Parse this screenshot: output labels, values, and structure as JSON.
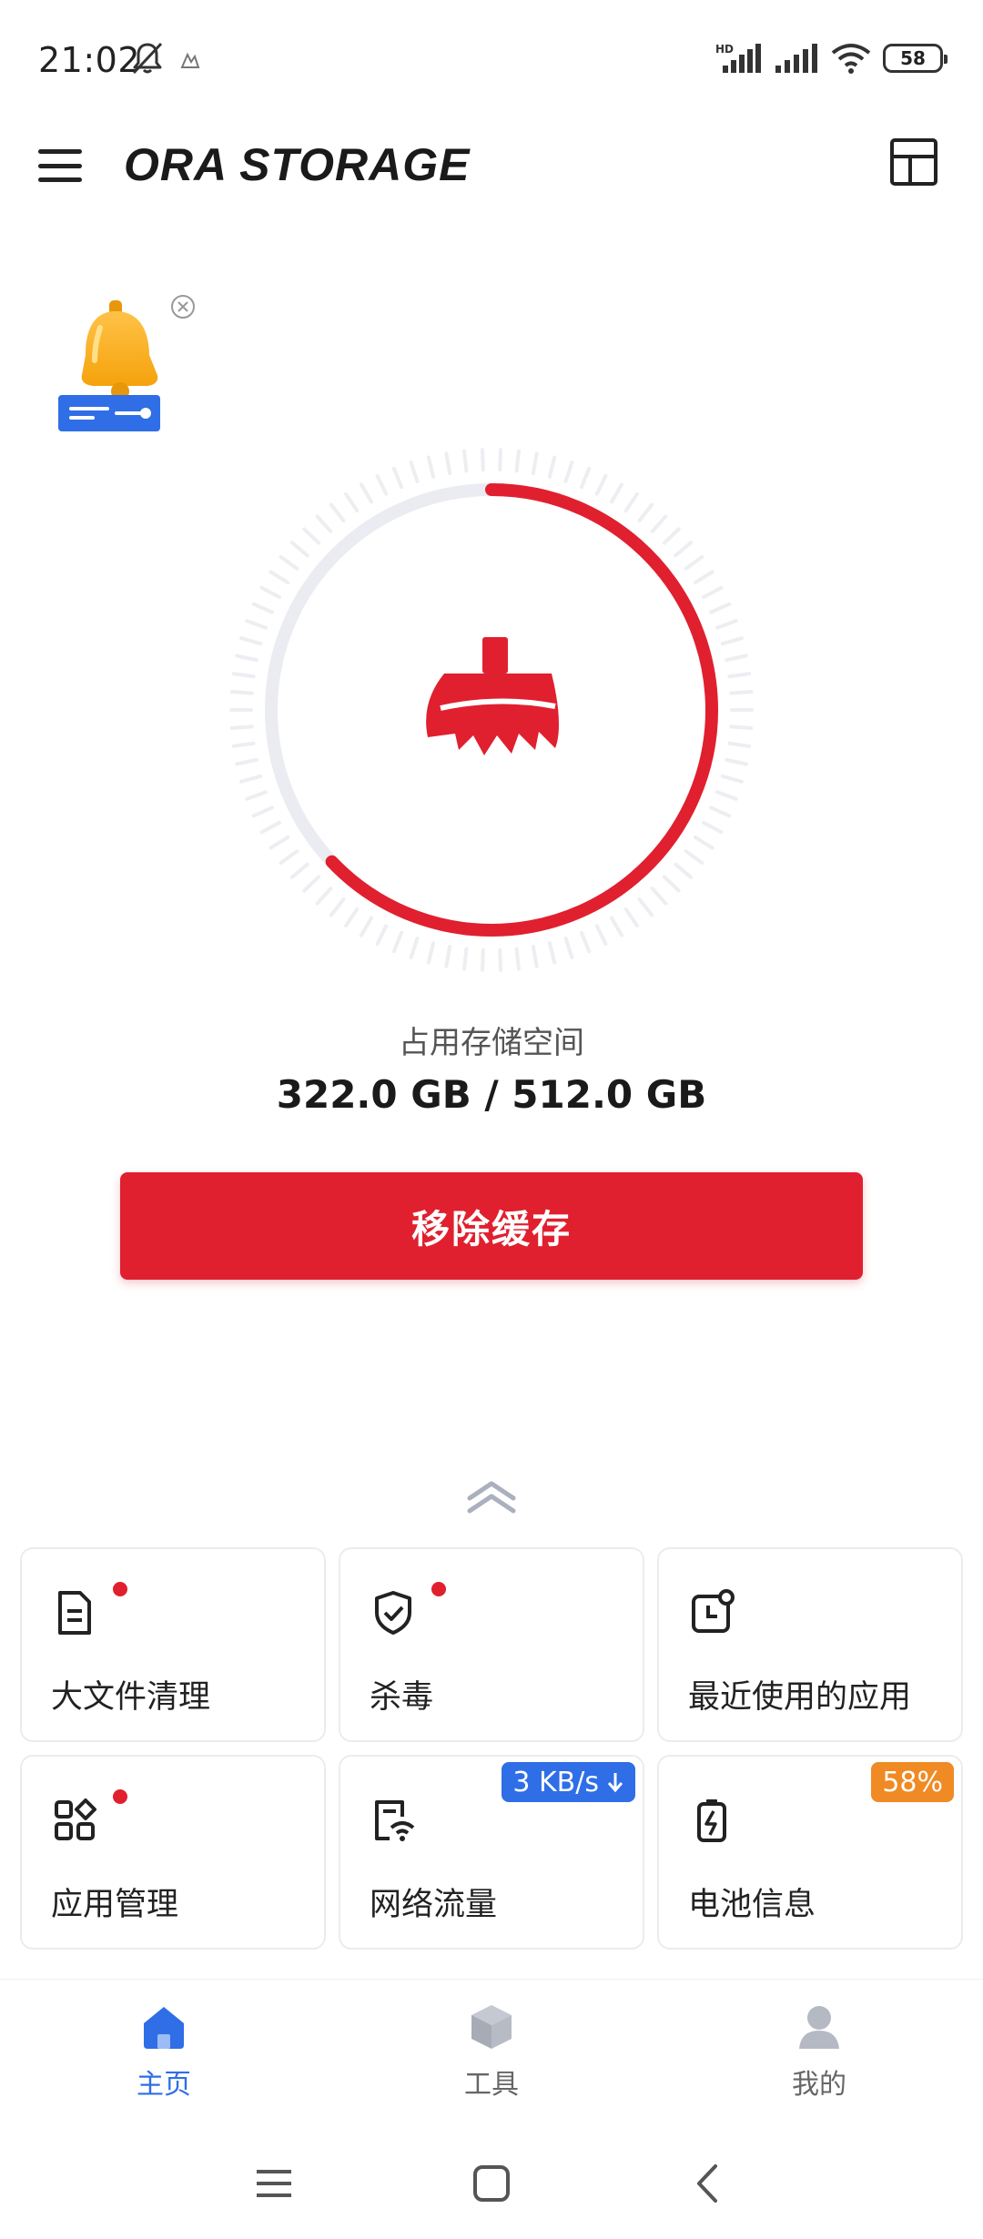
{
  "status_bar": {
    "time": "21:02",
    "network_tag": "HD",
    "battery_level": "58"
  },
  "header": {
    "brand": "ORA STORAGE"
  },
  "storage": {
    "label": "占用存储空间",
    "value_text": "322.0 GB / 512.0 GB",
    "used_gb": 322.0,
    "total_gb": 512.0,
    "used_fraction": 0.629
  },
  "actions": {
    "remove_cache_label": "移除缓存"
  },
  "tools": [
    {
      "label": "大文件清理",
      "icon": "file-icon",
      "dot": true
    },
    {
      "label": "杀毒",
      "icon": "shield-check-icon",
      "dot": true
    },
    {
      "label": "最近使用的应用",
      "icon": "recent-clock-icon",
      "dot": false
    },
    {
      "label": "应用管理",
      "icon": "apps-grid-icon",
      "dot": true
    },
    {
      "label": "网络流量",
      "icon": "network-traffic-icon",
      "dot": false,
      "badge": "3 KB/s"
    },
    {
      "label": "电池信息",
      "icon": "battery-charge-icon",
      "dot": false,
      "badge": "58%"
    }
  ],
  "bottom_nav": {
    "items": [
      {
        "label": "主页",
        "icon": "home-icon",
        "active": true
      },
      {
        "label": "工具",
        "icon": "tools-box-icon",
        "active": false
      },
      {
        "label": "我的",
        "icon": "profile-icon",
        "active": false
      }
    ]
  },
  "colors": {
    "accent_red": "#e0202f",
    "accent_blue": "#2f6ee6",
    "badge_orange": "#f08a24"
  }
}
